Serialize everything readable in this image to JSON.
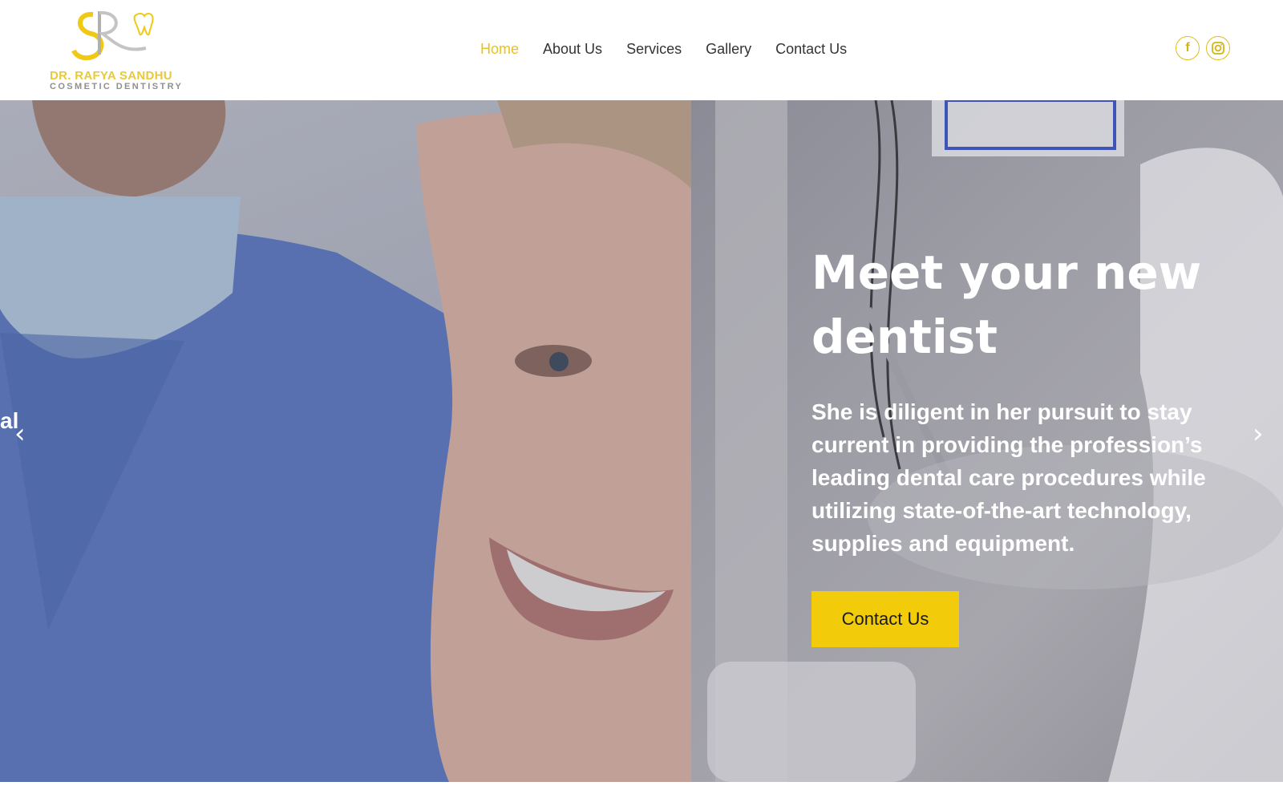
{
  "brand": {
    "name": "DR. RAFYA SANDHU",
    "subtitle": "COSMETIC DENTISTRY",
    "accent": "#f2cc0a"
  },
  "nav": {
    "items": [
      {
        "label": "Home",
        "active": true
      },
      {
        "label": "About Us"
      },
      {
        "label": "Services"
      },
      {
        "label": "Gallery"
      },
      {
        "label": "Contact Us"
      }
    ]
  },
  "social": {
    "facebook": "f",
    "icons": [
      "facebook-icon",
      "instagram-icon"
    ]
  },
  "hero": {
    "previous_slide_text": "al",
    "headline": "Meet your new dentist",
    "description": "She is diligent in her pursuit to stay current in providing the profession’s leading dental care procedures while utilizing state-of-the-art technology, supplies and equipment.",
    "cta_label": "Contact Us",
    "prev_arrow": "‹",
    "next_arrow": "›"
  }
}
